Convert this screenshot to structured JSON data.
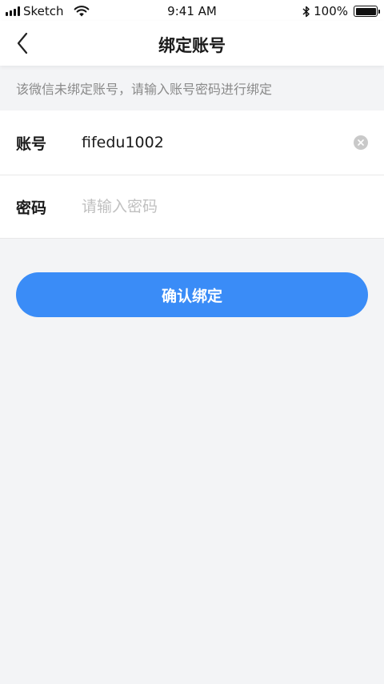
{
  "status_bar": {
    "carrier": "Sketch",
    "time": "9:41 AM",
    "battery": "100%"
  },
  "nav": {
    "title": "绑定账号",
    "back_icon": "chevron-left-icon"
  },
  "hint": "该微信未绑定账号，请输入账号密码进行绑定",
  "form": {
    "account_label": "账号",
    "account_value": "fifedu1002",
    "password_label": "密码",
    "password_placeholder": "请输入密码"
  },
  "confirm_label": "确认绑定",
  "colors": {
    "accent": "#3a8cf7",
    "background": "#f3f4f6"
  }
}
